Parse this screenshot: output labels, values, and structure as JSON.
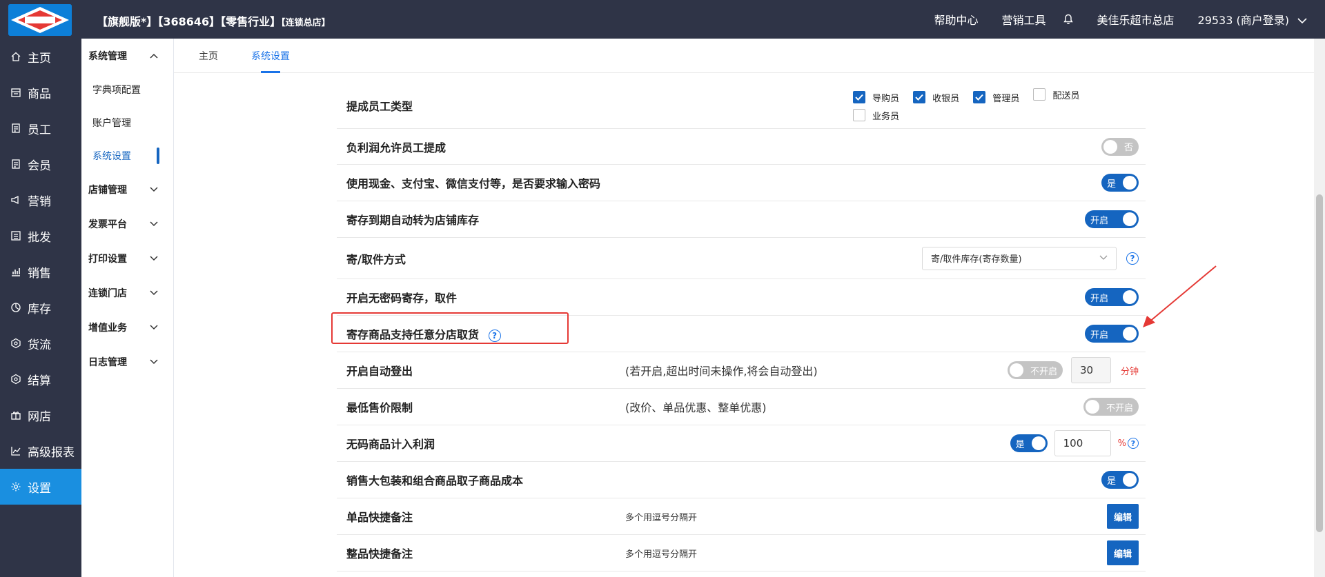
{
  "header": {
    "title": "【旗舰版*】【368646】【零售行业】",
    "title_small": "【连锁总店】",
    "help": "帮助中心",
    "marketing_tools": "营销工具",
    "store_name": "美佳乐超市总店",
    "account": "29533 (商户登录)"
  },
  "main_nav": [
    {
      "label": "主页",
      "icon": "home-icon"
    },
    {
      "label": "商品",
      "icon": "goods-icon"
    },
    {
      "label": "员工",
      "icon": "staff-icon"
    },
    {
      "label": "会员",
      "icon": "member-icon"
    },
    {
      "label": "营销",
      "icon": "marketing-icon"
    },
    {
      "label": "批发",
      "icon": "wholesale-icon"
    },
    {
      "label": "销售",
      "icon": "sales-icon"
    },
    {
      "label": "库存",
      "icon": "stock-icon"
    },
    {
      "label": "货流",
      "icon": "logistics-icon"
    },
    {
      "label": "结算",
      "icon": "settlement-icon"
    },
    {
      "label": "网店",
      "icon": "online-store-icon"
    },
    {
      "label": "高级报表",
      "icon": "report-icon"
    },
    {
      "label": "设置",
      "icon": "settings-icon"
    }
  ],
  "sub_nav": {
    "system_management": "系统管理",
    "dict_config": "字典项配置",
    "account_management": "账户管理",
    "system_settings": "系统设置",
    "store_management": "店铺管理",
    "invoice_platform": "发票平台",
    "print_settings": "打印设置",
    "chain_stores": "连锁门店",
    "value_added": "增值业务",
    "log_management": "日志管理"
  },
  "tabs": {
    "home": "主页",
    "system_settings": "系统设置"
  },
  "settings": {
    "commission_staff_type": {
      "label": "提成员工类型",
      "options": [
        {
          "label": "导购员",
          "checked": true
        },
        {
          "label": "收银员",
          "checked": true
        },
        {
          "label": "管理员",
          "checked": true
        },
        {
          "label": "配送员",
          "checked": false
        },
        {
          "label": "业务员",
          "checked": false
        }
      ]
    },
    "negative_profit": {
      "label": "负利润允许员工提成",
      "toggle": "否"
    },
    "payment_password": {
      "label": "使用现金、支付宝、微信支付等，是否要求输入密码",
      "toggle": "是"
    },
    "deposit_expire": {
      "label": "寄存到期自动转为店铺库存",
      "toggle": "开启"
    },
    "deposit_method": {
      "label": "寄/取件方式",
      "select": "寄/取件库存(寄存数量)"
    },
    "no_password_deposit": {
      "label": "开启无密码寄存，取件",
      "toggle": "开启"
    },
    "any_store_pickup": {
      "label": "寄存商品支持任意分店取货",
      "toggle": "开启"
    },
    "auto_logout": {
      "label": "开启自动登出",
      "hint": "(若开启,超出时间未操作,将会自动登出)",
      "toggle": "不开启",
      "minutes": "30",
      "unit": "分钟"
    },
    "min_price": {
      "label": "最低售价限制",
      "hint": "(改价、单品优惠、整单优惠)",
      "toggle": "不开启"
    },
    "no_code_profit": {
      "label": "无码商品计入利润",
      "toggle": "是",
      "percent": "100",
      "unit": "%"
    },
    "bulk_package_cost": {
      "label": "销售大包装和组合商品取子商品成本",
      "toggle": "是"
    },
    "item_remark": {
      "label": "单品快捷备注",
      "hint": "多个用逗号分隔开",
      "button": "编辑"
    },
    "order_remark": {
      "label": "整品快捷备注",
      "hint": "多个用逗号分隔开",
      "button": "编辑"
    }
  },
  "colors": {
    "sidebar": "#2f3447",
    "active_nav": "#1a8fe0",
    "primary": "#1565c0",
    "highlight": "#e53935"
  }
}
